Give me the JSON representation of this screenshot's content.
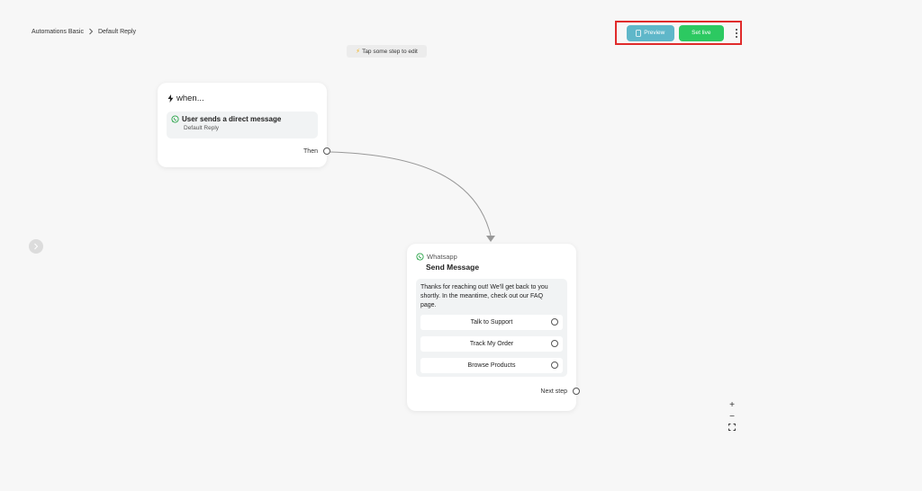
{
  "breadcrumb": {
    "parent": "Automations Basic",
    "current": "Default Reply"
  },
  "hint": {
    "text": "Tap some step to edit"
  },
  "toolbar": {
    "preview_label": "Preview",
    "live_label": "Set live",
    "preview_color": "#5fb7c9",
    "live_color": "#2cc961",
    "highlight_color": "#e02b2b"
  },
  "trigger": {
    "header": "when...",
    "title": "User sends a direct message",
    "subtitle": "Default Reply",
    "then_label": "Then"
  },
  "message": {
    "channel": "Whatsapp",
    "title": "Send Message",
    "text": "Thanks for reaching out! We'll get back to you shortly. In the meantime, check out our FAQ page.",
    "options": [
      {
        "label": "Talk to Support"
      },
      {
        "label": "Track My Order"
      },
      {
        "label": "Browse Products"
      }
    ],
    "next_label": "Next step"
  },
  "zoom": {
    "in": "+",
    "out": "−"
  }
}
